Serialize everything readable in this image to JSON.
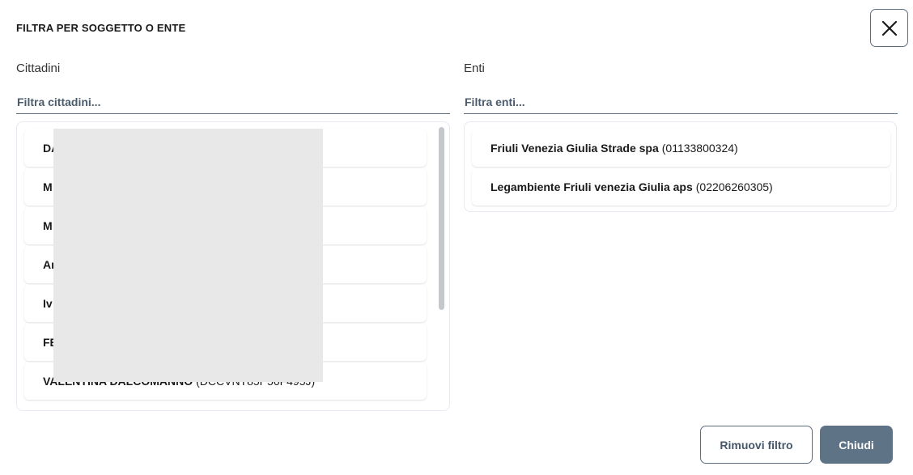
{
  "modal": {
    "title": "FILTRA PER SOGGETTO O ENTE"
  },
  "cittadini": {
    "label": "Cittadini",
    "placeholder": "Filtra cittadini...",
    "items": [
      {
        "name": "DA",
        "code": ""
      },
      {
        "name": "M",
        "code": ""
      },
      {
        "name": "M",
        "code": ""
      },
      {
        "name": "Ar",
        "code": ""
      },
      {
        "name": "Iv",
        "code": ""
      },
      {
        "name": "FE",
        "code": ""
      },
      {
        "name": "VALENTINA DALCOMANNO",
        "code": "(DCCVNT85P56F495J)"
      }
    ]
  },
  "enti": {
    "label": "Enti",
    "placeholder": "Filtra enti...",
    "items": [
      {
        "name": "Friuli Venezia Giulia Strade spa",
        "code": "(01133800324)"
      },
      {
        "name": "Legambiente Friuli venezia Giulia aps",
        "code": "(02206260305)"
      }
    ]
  },
  "footer": {
    "remove_label": "Rimuovi filtro",
    "close_label": "Chiudi"
  },
  "icons": {
    "close": "close-icon"
  },
  "colors": {
    "primary_button": "#5f7386",
    "border_accent": "#5c6f82"
  }
}
